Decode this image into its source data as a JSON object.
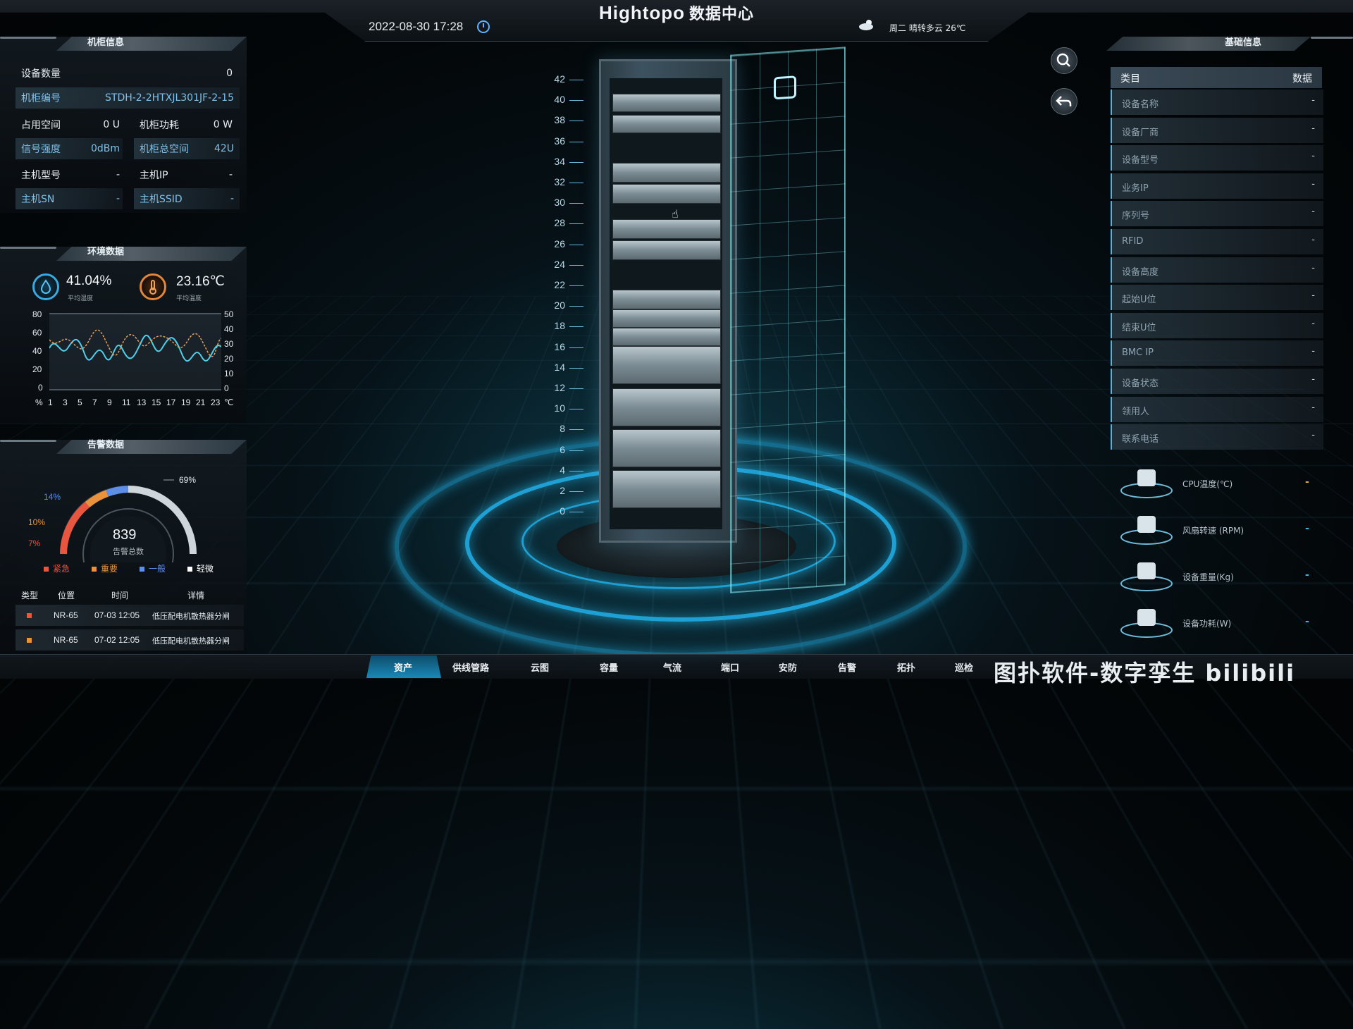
{
  "header": {
    "brand": "Hightopo",
    "brand_sub": "数据中心",
    "datetime": "2022-08-30 17:28",
    "weather": "周二   晴转多云 26℃"
  },
  "cabinet_info": {
    "title": "机柜信息",
    "device_count_label": "设备数量",
    "device_count": "0",
    "cabinet_no_label": "机柜编号",
    "cabinet_no": "STDH-2-2HTXJL301JF-2-15",
    "used_space_label": "占用空间",
    "used_space": "0 U",
    "cabinet_power_label": "机柜功耗",
    "cabinet_power": "0 W",
    "signal_label": "信号强度",
    "signal": "0dBm",
    "total_space_label": "机柜总空间",
    "total_space": "42U",
    "host_model_label": "主机型号",
    "host_model": "-",
    "host_ip_label": "主机IP",
    "host_ip": "-",
    "host_sn_label": "主机SN",
    "host_sn": "-",
    "host_ssid_label": "主机SSID",
    "host_ssid": "-"
  },
  "environment": {
    "title": "环境数据",
    "humidity": "41.04%",
    "humidity_label": "平均湿度",
    "temperature": "23.16℃",
    "temperature_label": "平均温度",
    "left_axis": [
      "80",
      "60",
      "40",
      "20",
      "0"
    ],
    "right_axis": [
      "50",
      "40",
      "30",
      "20",
      "10",
      "0"
    ],
    "left_unit": "%",
    "right_unit": "℃",
    "x_ticks": [
      "1",
      "3",
      "5",
      "7",
      "9",
      "11",
      "13",
      "15",
      "17",
      "19",
      "21",
      "23"
    ]
  },
  "alarm": {
    "title": "告警数据",
    "total": "839",
    "total_label": "告警总数",
    "pct_69": "69%",
    "pct_14": "14%",
    "pct_10": "10%",
    "pct_7": "7%",
    "legend": [
      "紧急",
      "重要",
      "一般",
      "轻微"
    ],
    "legend_colors": [
      "#e8563f",
      "#e9923b",
      "#5e8fe8",
      "#ffffff"
    ],
    "columns": [
      "类型",
      "位置",
      "时间",
      "详情"
    ],
    "rows": [
      {
        "location": "NR-65",
        "time": "07-03 12:05",
        "detail": "低压配电机散热器分闸"
      },
      {
        "location": "NR-65",
        "time": "07-02 12:05",
        "detail": "低压配电机散热器分闸"
      }
    ]
  },
  "basic_info": {
    "title": "基础信息",
    "col_item": "类目",
    "col_data": "数据",
    "rows": [
      {
        "label": "设备名称",
        "value": "-"
      },
      {
        "label": "设备厂商",
        "value": "-"
      },
      {
        "label": "设备型号",
        "value": "-"
      },
      {
        "label": "业务IP",
        "value": "-"
      },
      {
        "label": "序列号",
        "value": "-"
      },
      {
        "label": "RFID",
        "value": "-"
      },
      {
        "label": "设备高度",
        "value": "-"
      },
      {
        "label": "起始U位",
        "value": "-"
      },
      {
        "label": "结束U位",
        "value": "-"
      },
      {
        "label": "BMC IP",
        "value": "-"
      },
      {
        "label": "设备状态",
        "value": "-"
      },
      {
        "label": "领用人",
        "value": "-"
      },
      {
        "label": "联系电话",
        "value": "-"
      }
    ]
  },
  "metrics": [
    {
      "label": "CPU温度(℃)",
      "value": "-",
      "color": "#e8a93b"
    },
    {
      "label": "风扇转速 (RPM)",
      "value": "-",
      "color": "#39b6e6"
    },
    {
      "label": "设备重量(Kg)",
      "value": "-",
      "color": "#39b6e6"
    },
    {
      "label": "设备功耗(W)",
      "value": "-",
      "color": "#39b6e6"
    }
  ],
  "rack_scale": [
    "42",
    "40",
    "38",
    "36",
    "34",
    "32",
    "30",
    "28",
    "26",
    "24",
    "22",
    "20",
    "18",
    "16",
    "14",
    "12",
    "10",
    "8",
    "6",
    "4",
    "2",
    "0"
  ],
  "bottom_nav": [
    "资产",
    "供线管路",
    "云图",
    "容量",
    "气流",
    "端口",
    "安防",
    "告警",
    "拓扑",
    "巡检"
  ],
  "footer_text": "图扑软件-数字孪生 bilibili"
}
